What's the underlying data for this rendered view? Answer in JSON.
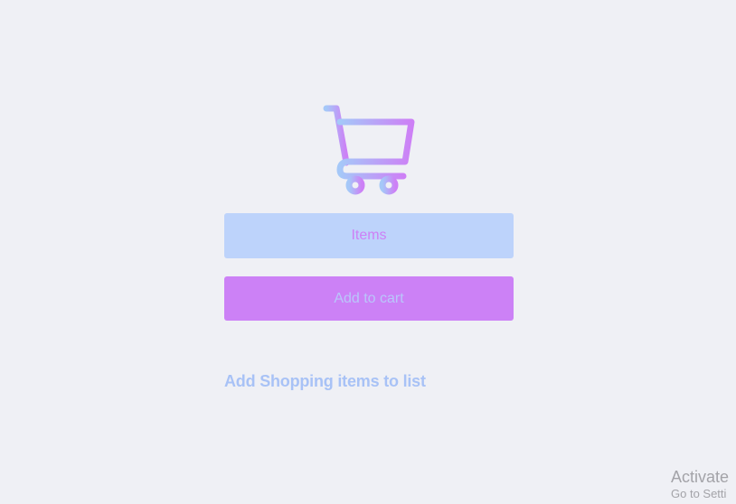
{
  "logo": {
    "icon": "shopping-cart-icon",
    "gradient_start": "#a5c8f8",
    "gradient_end": "#cd80f6"
  },
  "form": {
    "items_placeholder": "Items",
    "add_button_label": "Add to cart"
  },
  "list": {
    "heading": "Add Shopping items to list"
  },
  "windows_watermark": {
    "title": "Activate",
    "subtitle": "Go to Setti"
  },
  "colors": {
    "background": "#eff0f5",
    "input_bg": "#bdd3fb",
    "button_bg": "#cc81f6",
    "heading": "#a8c2f6"
  }
}
